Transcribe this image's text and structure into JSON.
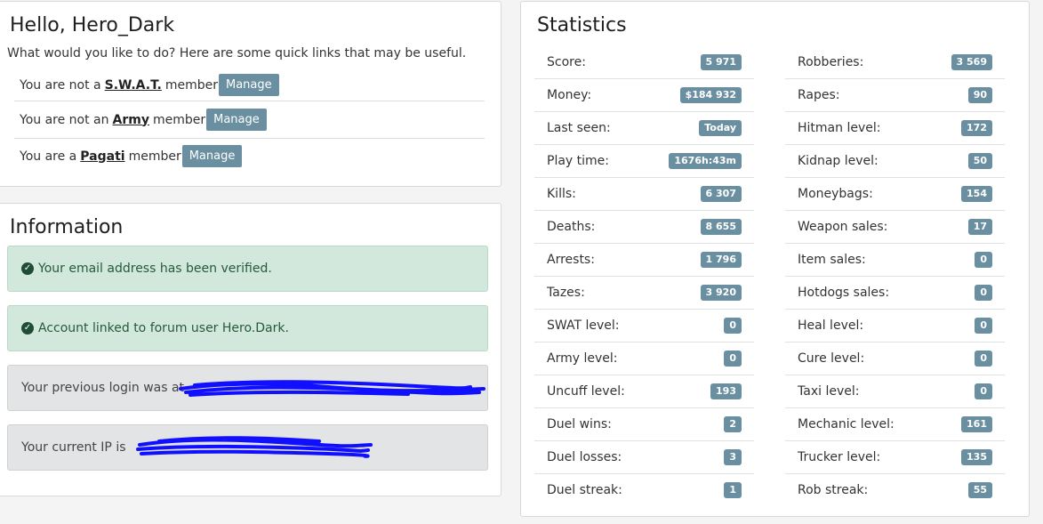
{
  "hello": {
    "title": "Hello, Hero_Dark",
    "subtitle": "What would you like to do? Here are some quick links that may be useful.",
    "memberships": [
      {
        "prefix": "You are not a",
        "group": "S.W.A.T.",
        "suffix": "member",
        "button": "Manage"
      },
      {
        "prefix": "You are not an",
        "group": "Army",
        "suffix": "member",
        "button": "Manage"
      },
      {
        "prefix": "You are a",
        "group": "Pagati",
        "suffix": "member",
        "button": "Manage"
      }
    ]
  },
  "information": {
    "title": "Information",
    "alerts": [
      {
        "text": "Your email address has been verified.",
        "type": "success"
      },
      {
        "text": "Account linked to forum user Hero.Dark.",
        "type": "success"
      },
      {
        "text": "Your previous login was at",
        "type": "grey"
      },
      {
        "text": "Your current IP is",
        "type": "grey"
      }
    ]
  },
  "statistics": {
    "title": "Statistics",
    "left": [
      {
        "label": "Score:",
        "value": "5 971"
      },
      {
        "label": "Money:",
        "value": "$184 932"
      },
      {
        "label": "Last seen:",
        "value": "Today"
      },
      {
        "label": "Play time:",
        "value": "1676h:43m"
      },
      {
        "label": "Kills:",
        "value": "6 307"
      },
      {
        "label": "Deaths:",
        "value": "8 655"
      },
      {
        "label": "Arrests:",
        "value": "1 796"
      },
      {
        "label": "Tazes:",
        "value": "3 920"
      },
      {
        "label": "SWAT level:",
        "value": "0"
      },
      {
        "label": "Army level:",
        "value": "0"
      },
      {
        "label": "Uncuff level:",
        "value": "193"
      },
      {
        "label": "Duel wins:",
        "value": "2"
      },
      {
        "label": "Duel losses:",
        "value": "3"
      },
      {
        "label": "Duel streak:",
        "value": "1"
      }
    ],
    "right": [
      {
        "label": "Robberies:",
        "value": "3 569"
      },
      {
        "label": "Rapes:",
        "value": "90"
      },
      {
        "label": "Hitman level:",
        "value": "172"
      },
      {
        "label": "Kidnap level:",
        "value": "50"
      },
      {
        "label": "Moneybags:",
        "value": "154"
      },
      {
        "label": "Weapon sales:",
        "value": "17"
      },
      {
        "label": "Item sales:",
        "value": "0"
      },
      {
        "label": "Hotdogs sales:",
        "value": "0"
      },
      {
        "label": "Heal level:",
        "value": "0"
      },
      {
        "label": "Cure level:",
        "value": "0"
      },
      {
        "label": "Taxi level:",
        "value": "0"
      },
      {
        "label": "Mechanic level:",
        "value": "161"
      },
      {
        "label": "Trucker level:",
        "value": "135"
      },
      {
        "label": "Rob streak:",
        "value": "55"
      }
    ]
  },
  "colors": {
    "badge": "#6a8fa1",
    "success_bg": "#d3e8dc",
    "grey_bg": "#e3e4e6",
    "redaction": "#1010ff"
  }
}
